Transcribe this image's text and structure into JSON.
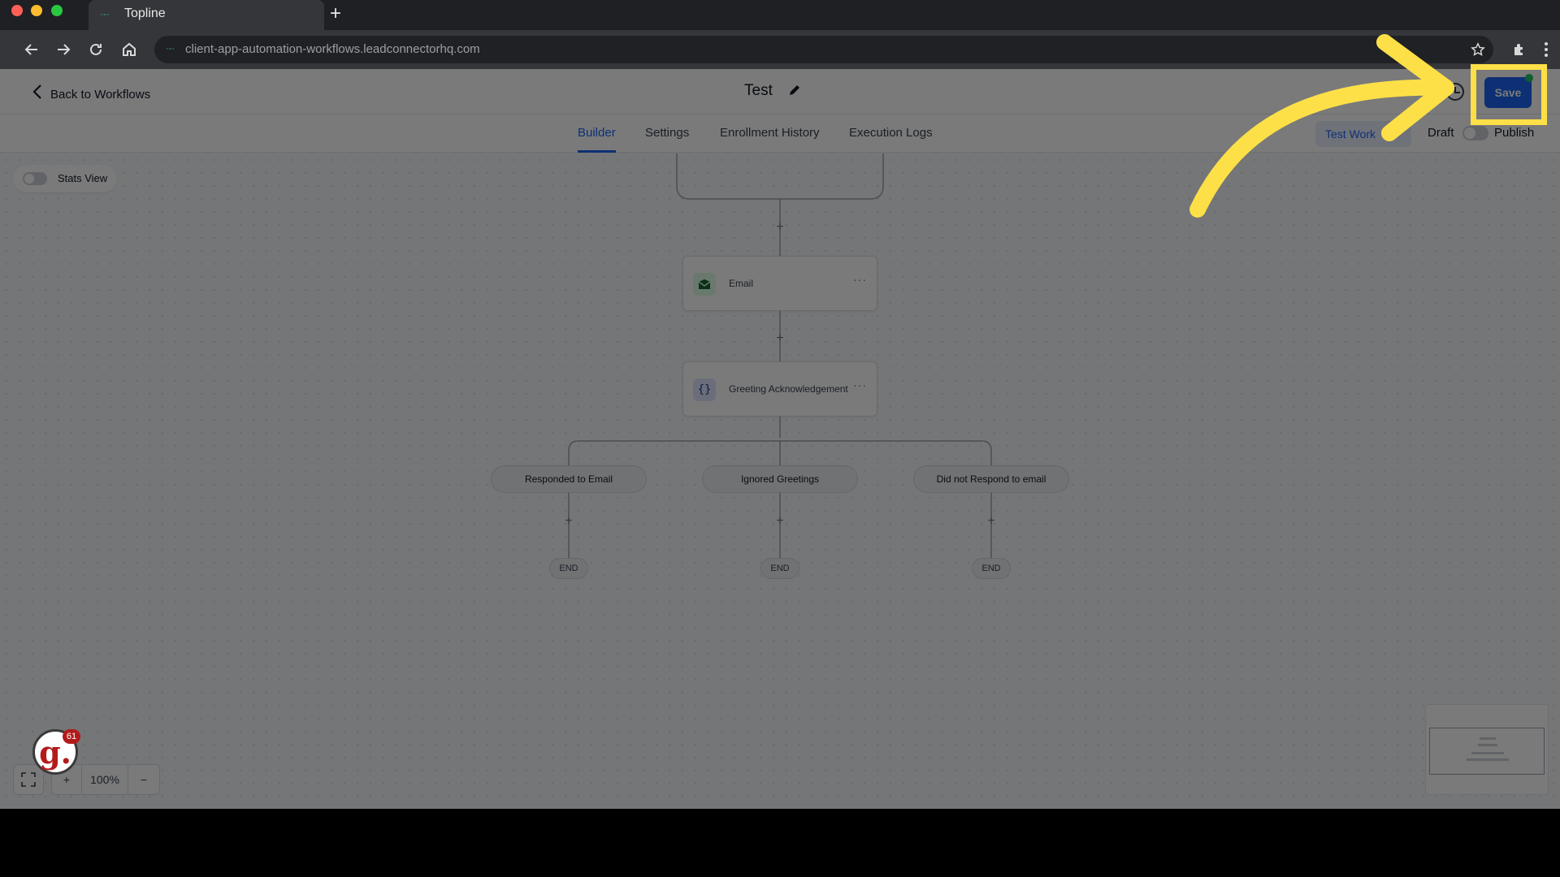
{
  "browser": {
    "tab_title": "Topline",
    "new_tab_label": "+",
    "url": "client-app-automation-workflows.leadconnectorhq.com",
    "icons": [
      "back-arrow-icon",
      "forward-arrow-icon",
      "reload-icon",
      "home-icon",
      "star-icon",
      "extensions-icon",
      "kebab-menu-icon"
    ]
  },
  "header": {
    "back_label": "Back to Workflows",
    "title": "Test",
    "save_label": "Save"
  },
  "tabs": [
    {
      "label": "Builder",
      "active": true
    },
    {
      "label": "Settings",
      "active": false
    },
    {
      "label": "Enrollment History",
      "active": false
    },
    {
      "label": "Execution Logs",
      "active": false
    }
  ],
  "actions": {
    "test_workflow_label": "Test Work",
    "draft_label": "Draft",
    "publish_label": "Publish",
    "publish_on": false
  },
  "canvas": {
    "stats_view_label": "Stats View",
    "stats_view_on": false,
    "nodes": [
      {
        "label": "Email",
        "icon": "email-icon",
        "menu": "···"
      },
      {
        "label": "Greeting Acknowledgement",
        "icon": "braces-icon",
        "glyph": "{}",
        "menu": "···"
      }
    ],
    "branches": [
      "Responded to Email",
      "Ignored Greetings",
      "Did not Respond to email"
    ],
    "end_label": "END",
    "plus_label": "+"
  },
  "zoom": {
    "level": "100%",
    "zoom_in": "+",
    "zoom_out": "−"
  },
  "badge": {
    "letter": "g.",
    "count": "61"
  },
  "colors": {
    "accent": "#1d64f2",
    "highlight": "#fde047",
    "status_dot": "#22c55e"
  }
}
